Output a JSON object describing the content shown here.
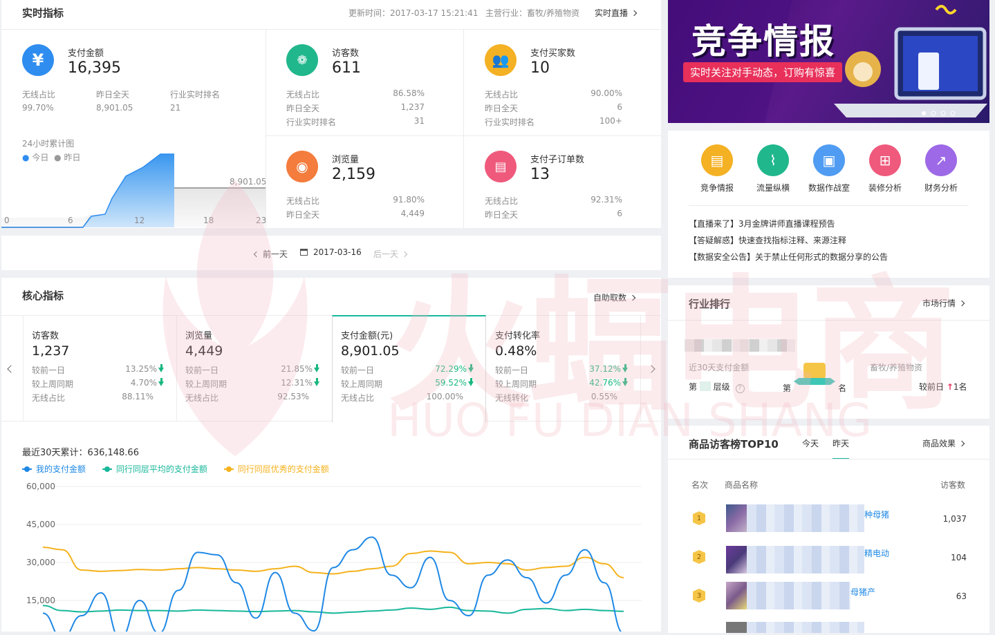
{
  "realtime": {
    "title": "实时指标",
    "update_time": "更新时间：2017-03-17 15:21:41",
    "industry": "主营行业：畜牧/养殖物资",
    "live_link": "实时直播",
    "pay": {
      "label": "支付金额",
      "value": "16,395",
      "sub_labels": [
        "无线占比",
        "昨日全天",
        "行业实时排名"
      ],
      "sub_values": [
        "99.70%",
        "8,901.05",
        "21"
      ]
    },
    "chart": {
      "title": "24小时累计图",
      "legend_today": "今日",
      "legend_yesterday": "昨日",
      "yesterday_value_label": "8,901.05",
      "ticks": [
        "0",
        "6",
        "12",
        "18",
        "23"
      ]
    },
    "visitors": {
      "label": "访客数",
      "value": "611",
      "rows": [
        [
          "无线占比",
          "86.58%"
        ],
        [
          "昨日全天",
          "1,237"
        ],
        [
          "行业实时排名",
          "31"
        ]
      ]
    },
    "buyers": {
      "label": "支付买家数",
      "value": "10",
      "rows": [
        [
          "无线占比",
          "90.00%"
        ],
        [
          "昨日全天",
          "6"
        ],
        [
          "行业实时排名",
          "100+"
        ]
      ]
    },
    "pageviews": {
      "label": "浏览量",
      "value": "2,159",
      "rows": [
        [
          "无线占比",
          "91.80%"
        ],
        [
          "昨日全天",
          "4,449"
        ]
      ]
    },
    "suborders": {
      "label": "支付子订单数",
      "value": "13",
      "rows": [
        [
          "无线占比",
          "92.31%"
        ],
        [
          "昨日全天",
          "6"
        ]
      ]
    }
  },
  "datenav": {
    "prev": "前一天",
    "date": "2017-03-16",
    "next": "后一天"
  },
  "core": {
    "title": "核心指标",
    "self_fetch": "自助取数",
    "metrics": [
      {
        "label": "访客数",
        "value": "1,237",
        "rows": [
          [
            "较前一日",
            "13.25%"
          ],
          [
            "较上周同期",
            "4.70%"
          ],
          [
            "无线占比",
            "88.11%"
          ]
        ]
      },
      {
        "label": "浏览量",
        "value": "4,449",
        "rows": [
          [
            "较前一日",
            "21.85%"
          ],
          [
            "较上周同期",
            "12.31%"
          ],
          [
            "无线占比",
            "92.53%"
          ]
        ]
      },
      {
        "label": "支付金额(元)",
        "value": "8,901.05",
        "rows": [
          [
            "较前一日",
            "72.29%"
          ],
          [
            "较上周同期",
            "59.52%"
          ],
          [
            "无线占比",
            "100.00%"
          ]
        ]
      },
      {
        "label": "支付转化率",
        "value": "0.48%",
        "rows": [
          [
            "较前一日",
            "37.12%"
          ],
          [
            "较上周同期",
            "42.76%"
          ],
          [
            "无线转化",
            "0.55%"
          ]
        ]
      }
    ],
    "total": "最近30天累计：636,148.66",
    "legend": [
      "我的支付金额",
      "同行同层平均的支付金额",
      "同行同层优秀的支付金额"
    ],
    "colors": {
      "mine": "#1e88e5",
      "avg": "#18b79a",
      "excellent": "#f5b21c"
    }
  },
  "chart_data": {
    "type": "line",
    "title": "最近30天累计：636,148.66",
    "ylim": [
      0,
      60000
    ],
    "yticks": [
      "60,000",
      "45,000",
      "30,000",
      "15,000"
    ],
    "series": [
      {
        "name": "我的支付金额",
        "values": [
          10000,
          0,
          9000,
          18000,
          0,
          15000,
          2000,
          19000,
          34000,
          33000,
          22000,
          8000,
          26000,
          10000,
          3000,
          28000,
          35000,
          40000,
          25000,
          20000,
          32000,
          15000,
          9000,
          25000,
          31000,
          24000,
          14000,
          25000,
          35000,
          22000,
          2000
        ]
      },
      {
        "name": "同行同层平均的支付金额",
        "values": [
          13000,
          11000,
          10500,
          10800,
          11200,
          11000,
          11000,
          10800,
          11200,
          11000,
          10800,
          10600,
          10800,
          11000,
          10500,
          10000,
          10400,
          10800,
          11200,
          12000,
          11500,
          12300,
          11000,
          10800,
          10000,
          11500,
          11800,
          11000,
          11500,
          11000,
          10700
        ]
      },
      {
        "name": "同行同层优秀的支付金额",
        "values": [
          36000,
          35000,
          27000,
          26500,
          26800,
          27200,
          27000,
          27500,
          28000,
          27500,
          27000,
          26500,
          27500,
          28500,
          26000,
          25500,
          26500,
          27500,
          28500,
          33500,
          34500,
          34000,
          29500,
          30000,
          29500,
          27000,
          28000,
          28500,
          32000,
          29500,
          24000
        ]
      }
    ]
  },
  "banner": {
    "title": "竞争情报",
    "subtitle": "实时关注对手动态，订购有惊喜"
  },
  "quicklinks": {
    "items": [
      "竞争情报",
      "流量纵横",
      "数据作战室",
      "装修分析",
      "财务分析"
    ],
    "colors": [
      "#f4b124",
      "#21b78d",
      "#4f9cf2",
      "#ef5a7c",
      "#9d69e6"
    ],
    "notices": [
      "【直播来了】3月金牌讲师直播课程预告",
      "【答疑解惑】快速查找指标注释、来源注释",
      "【数据安全公告】关于禁止任何形式的数据分享的公告"
    ]
  },
  "ranking": {
    "title": "行业排行",
    "market_link": "市场行情",
    "metric": "近30天支付金额",
    "industry": "畜牧/养殖物资",
    "tier_prefix": "第",
    "tier_suffix": "层级",
    "rank_prefix": "第",
    "rank_suffix": "名",
    "compare_label": "较前日",
    "compare_value": "1名"
  },
  "top10": {
    "title": "商品访客榜TOP10",
    "tab_today": "今天",
    "tab_yesterday": "昨天",
    "effect_link": "商品效果",
    "col_rank": "名次",
    "col_name": "商品名称",
    "col_visitors": "访客数",
    "rows": [
      {
        "rank": "1",
        "name_tail": "种母猪",
        "visitors": "1,037"
      },
      {
        "rank": "2",
        "name_tail": "精电动",
        "visitors": "104"
      },
      {
        "rank": "3",
        "name_tail": "母猪产",
        "visitors": "63"
      }
    ]
  },
  "watermark": {
    "cn": "火蝠电商",
    "en": "HUO FU DIAN SHANG"
  }
}
